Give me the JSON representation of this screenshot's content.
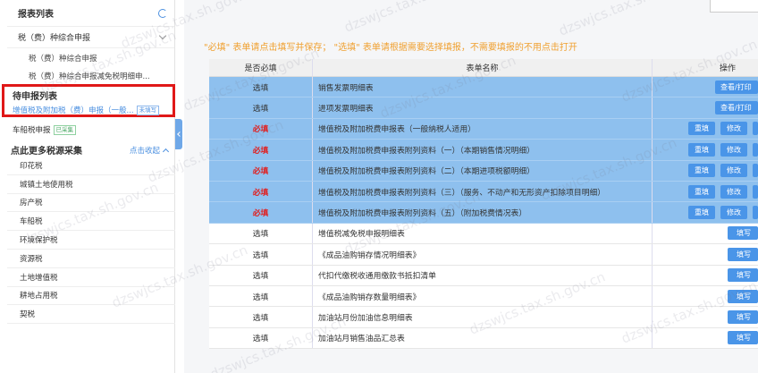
{
  "sidebar": {
    "title": "报表列表",
    "group_label": "税（费）种综合申报",
    "sub_items": [
      "税（费）种综合申报",
      "税（费）种综合申报减免税明细申..."
    ],
    "pending": {
      "title": "待申报列表",
      "item_label": "增值税及附加税（费）申报（一般...",
      "item_tag": "未填写"
    },
    "car_tax": {
      "label": "车船税申报",
      "tag": "已采集"
    },
    "more": {
      "title": "点此更多税源采集",
      "collapse_label": "点击收起"
    },
    "tax_items": [
      "印花税",
      "城镇土地使用税",
      "房产税",
      "车船税",
      "环境保护税",
      "资源税",
      "土地增值税",
      "耕地占用税",
      "契税"
    ]
  },
  "notice": "\"必填\" 表单请点击填写并保存； \"选填\" 表单请根据需要选择填报，不需要填报的不用点击打开",
  "table": {
    "headers": {
      "required": "是否必填",
      "name": "表单名称",
      "ops": "操作"
    },
    "rows": [
      {
        "req": "选填",
        "name": "销售发票明细表",
        "buttons": [
          "查看/打印"
        ],
        "selected": true
      },
      {
        "req": "选填",
        "name": "进项发票明细表",
        "buttons": [
          "查看/打印"
        ],
        "selected": true
      },
      {
        "req": "必填",
        "name": "增值税及附加税费申报表（一般纳税人适用）",
        "buttons": [
          "重填",
          "修改",
          ""
        ],
        "selected": true
      },
      {
        "req": "必填",
        "name": "增值税及附加税费申报表附列资料（一）（本期销售情况明细）",
        "buttons": [
          "重填",
          "修改",
          ""
        ],
        "selected": true
      },
      {
        "req": "必填",
        "name": "增值税及附加税费申报表附列资料（二）（本期进项税额明细）",
        "buttons": [
          "重填",
          "修改",
          ""
        ],
        "selected": true
      },
      {
        "req": "必填",
        "name": "增值税及附加税费申报表附列资料（三）（服务、不动产和无形资产扣除项目明细）",
        "buttons": [
          "重填",
          "修改",
          ""
        ],
        "selected": true
      },
      {
        "req": "必填",
        "name": "增值税及附加税费申报表附列资料（五）（附加税费情况表）",
        "buttons": [
          "重填",
          "修改",
          ""
        ],
        "selected": true
      },
      {
        "req": "选填",
        "name": "增值税减免税申报明细表",
        "buttons": [
          "填写"
        ],
        "selected": false
      },
      {
        "req": "选填",
        "name": "《成品油购销存情况明细表》",
        "buttons": [
          "填写"
        ],
        "selected": false
      },
      {
        "req": "选填",
        "name": "代扣代缴税收通用缴款书抵扣清单",
        "buttons": [
          "填写"
        ],
        "selected": false
      },
      {
        "req": "选填",
        "name": "《成品油购销存数量明细表》",
        "buttons": [
          "填写"
        ],
        "selected": false
      },
      {
        "req": "选填",
        "name": "加油站月份加油信息明细表",
        "buttons": [
          "填写"
        ],
        "selected": false
      },
      {
        "req": "选填",
        "name": "加油站月销售油品汇总表",
        "buttons": [
          "填写"
        ],
        "selected": false
      }
    ]
  },
  "watermark": "dzswjcs.tax.sh.gov.cn",
  "colors": {
    "accent": "#4a95e8",
    "selected_row": "#8ec0ee",
    "required": "#e02020",
    "notice": "#f0a030",
    "highlight_box": "#e01818"
  }
}
